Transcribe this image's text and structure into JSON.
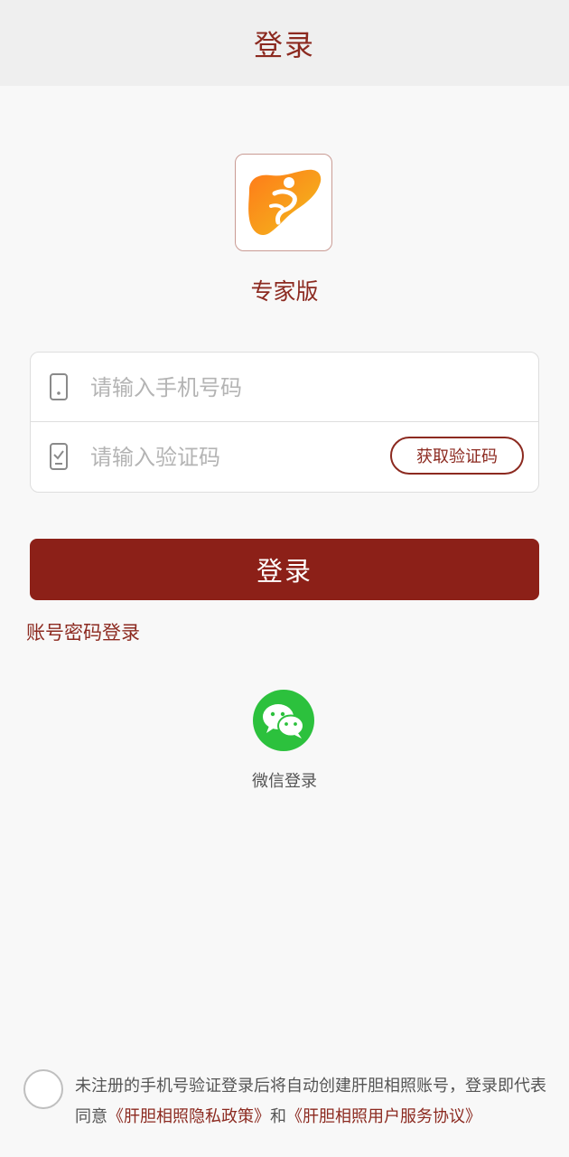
{
  "header": {
    "title": "登录"
  },
  "app": {
    "subtitle": "专家版",
    "logo_icon": "liver-runner-logo"
  },
  "form": {
    "phone_placeholder": "请输入手机号码",
    "phone_icon": "phone-icon",
    "code_placeholder": "请输入验证码",
    "code_icon": "checkmark-phone-icon",
    "get_code_label": "获取验证码"
  },
  "actions": {
    "login_label": "登录",
    "password_login_label": "账号密码登录"
  },
  "wechat": {
    "label": "微信登录",
    "icon": "wechat-icon"
  },
  "agreement": {
    "text_before": "未注册的手机号验证登录后将自动创建肝胆相照账号，登录即代表同意",
    "privacy_link": "《肝胆相照隐私政策》",
    "and": "和",
    "service_link": "《肝胆相照用户服务协议》"
  },
  "colors": {
    "brand": "#8c2018",
    "wechat": "#2cc13d",
    "background": "#f8f8f8"
  }
}
